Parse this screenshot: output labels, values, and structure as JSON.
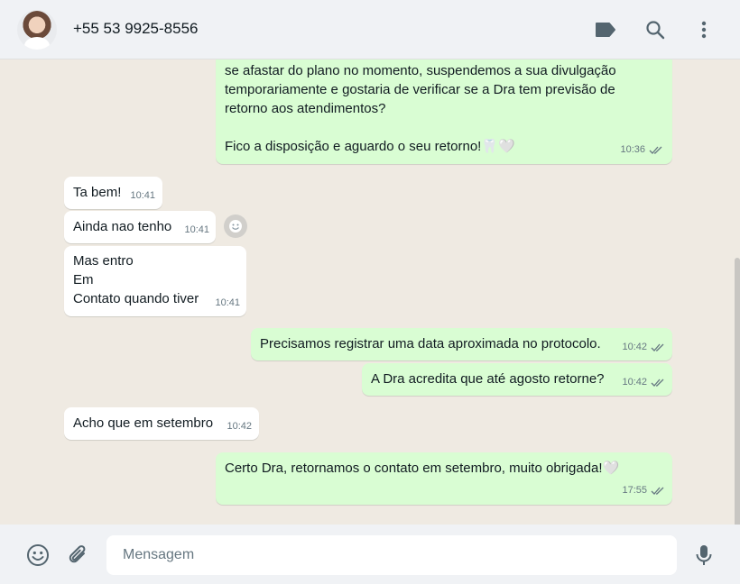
{
  "header": {
    "contact_name": "+55 53 9925-8556",
    "icons": [
      "label-icon",
      "search-icon",
      "menu-icon"
    ]
  },
  "messages": [
    {
      "direction": "out",
      "text": "se afastar do plano no momento, suspendemos a sua divulgação\ntemporariamente e gostaria de verificar se a Dra tem previsão de\nretorno aos atendimentos?\n\n Fico a disposição e aguardo o seu retorno!🦷🤍",
      "time": "10:36",
      "read": true
    },
    {
      "direction": "in",
      "text": "Ta bem!",
      "time": "10:41"
    },
    {
      "direction": "in",
      "text": "Ainda nao tenho",
      "time": "10:41"
    },
    {
      "direction": "in",
      "text": "Mas entro\nEm\nContato quando tiver",
      "time": "10:41"
    },
    {
      "direction": "out",
      "text": "Precisamos registrar uma data aproximada no protocolo.",
      "time": "10:42",
      "read": true
    },
    {
      "direction": "out",
      "text": "A Dra acredita que até agosto retorne?",
      "time": "10:42",
      "read": true
    },
    {
      "direction": "in",
      "text": "Acho que em setembro",
      "time": "10:42"
    },
    {
      "direction": "out",
      "text": "Certo Dra, retornamos o contato em setembro, muito obrigada!🤍",
      "time": "17:55",
      "read": true
    }
  ],
  "composer": {
    "placeholder": "Mensagem",
    "icons": [
      "emoji-icon",
      "attach-icon",
      "mic-icon"
    ]
  },
  "colors": {
    "outgoing_bubble": "#d9fdd3",
    "incoming_bubble": "#ffffff",
    "chat_background": "#efeae2",
    "read_ticks": "#53bdeb"
  }
}
